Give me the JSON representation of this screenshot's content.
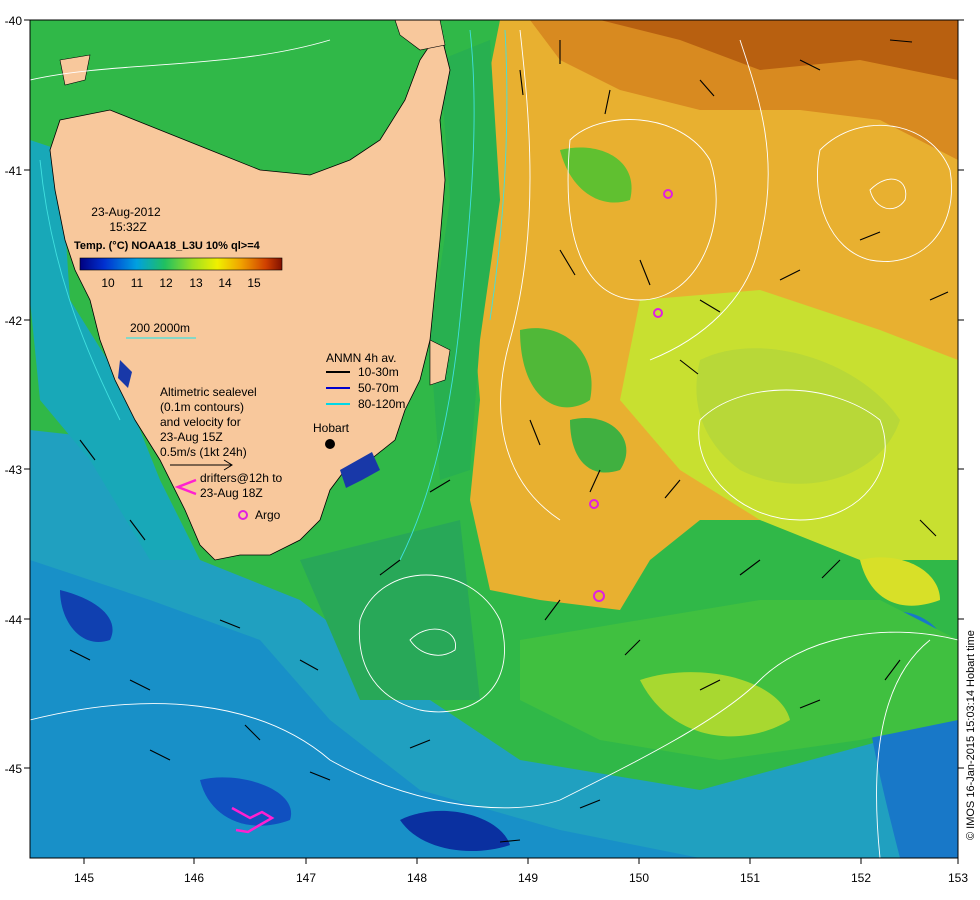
{
  "map": {
    "date": "23-Aug-2012",
    "time": "15:32Z",
    "product_title": "Temp. (°C) NOAA18_L3U 10% ql>=4",
    "colorbar_ticks": [
      "10",
      "11",
      "12",
      "13",
      "14",
      "15"
    ],
    "bathymetry_legend": "200  2000m",
    "anmn_title": "ANMN 4h av.",
    "anmn_items": [
      {
        "label": "10-30m",
        "color": "#000000"
      },
      {
        "label": "50-70m",
        "color": "#0000cc"
      },
      {
        "label": "80-120m",
        "color": "#00d8e8"
      }
    ],
    "altimetry_lines": [
      "Altimetric sealevel",
      "(0.1m contours)",
      "and velocity for",
      "23-Aug 15Z",
      "0.5m/s (1kt 24h)"
    ],
    "drifters_lines": [
      "drifters@12h to",
      "23-Aug 18Z"
    ],
    "argo_label": "Argo",
    "city_label": "Hobart",
    "credit": "© IMOS 16-Jan-2015 15:03:14 Hobart time",
    "lon_ticks": [
      "145",
      "146",
      "147",
      "148",
      "149",
      "150",
      "151",
      "152",
      "153"
    ],
    "lat_ticks": [
      "-40",
      "-41",
      "-42",
      "-43",
      "-44",
      "-45"
    ],
    "colors": {
      "land": "#f8c89c",
      "sst_warm": "#e0a030",
      "sst_mid": "#c8e020",
      "sst_cool": "#20b040",
      "sst_cold": "#1060d0",
      "contour": "#ffffff",
      "argo": "#e020e0",
      "drifter": "#ff20d0"
    }
  }
}
